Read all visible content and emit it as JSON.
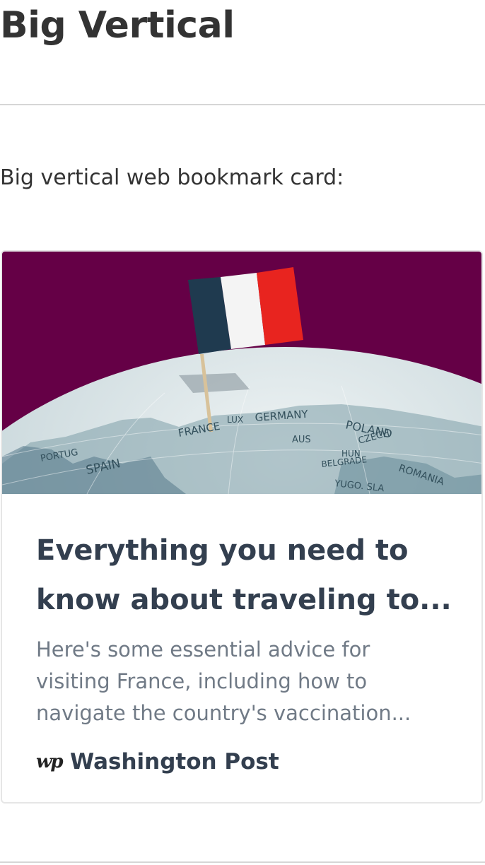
{
  "page": {
    "title": "Big Vertical",
    "intro": "Big vertical web bookmark card:"
  },
  "bookmark": {
    "title_line1": "Everything you need to",
    "title_line2": "know about traveling to...",
    "description_lines": [
      "Here's some essential advice for",
      "visiting France, including how to",
      "navigate the country's vaccination..."
    ],
    "publisher": "Washington Post",
    "publisher_logo_text": "wp",
    "image_labels": {
      "germany": "GERMANY",
      "poland": "POLAND",
      "france": "FRANCE",
      "spain": "SPAIN",
      "portugal": "PORTUG",
      "romania": "ROMANIA",
      "czech": "CZECH",
      "belgrade": "BELGRADE",
      "hun": "HUN",
      "aus": "AUS",
      "lux": "LUX",
      "yugo": "YUGO. SLA"
    },
    "image_colors": {
      "background": "#650046",
      "flag_blue": "#1f3a4f",
      "flag_white": "#f4f4f4",
      "flag_red": "#e8241f",
      "globe": "#c8d7dc"
    }
  }
}
